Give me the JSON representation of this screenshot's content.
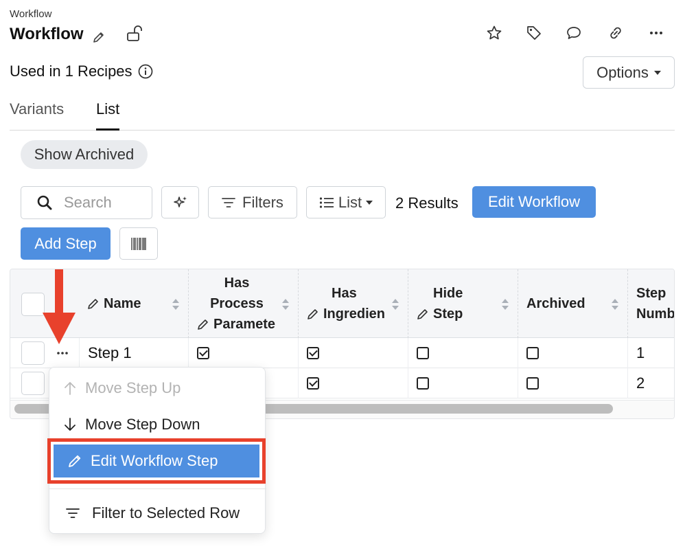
{
  "header": {
    "breadcrumb": "Workflow",
    "title": "Workflow",
    "used_in": "Used in 1 Recipes",
    "options_label": "Options"
  },
  "tabs": [
    {
      "label": "Variants",
      "active": false
    },
    {
      "label": "List",
      "active": true
    }
  ],
  "toolbar": {
    "show_archived": "Show Archived",
    "search_placeholder": "Search",
    "filters_label": "Filters",
    "list_label": "List",
    "results": "2 Results",
    "edit_workflow": "Edit Workflow",
    "add_step": "Add Step"
  },
  "table": {
    "columns": [
      {
        "label": "Name",
        "editable": true
      },
      {
        "label": "Has Process Paramete",
        "editable": true
      },
      {
        "label": "Has Ingredien",
        "editable": true
      },
      {
        "label": "Hide Step",
        "editable": true
      },
      {
        "label": "Archived",
        "editable": false
      },
      {
        "label": "Step Numb",
        "editable": false
      }
    ],
    "col_lines": {
      "c1": "Name",
      "c2a": "Has",
      "c2b": "Process",
      "c2c": "Paramete",
      "c3a": "Has",
      "c3b": "Ingredien",
      "c4a": "Hide",
      "c4b": "Step",
      "c5": "Archived",
      "c6a": "Step",
      "c6b": "Numb"
    },
    "rows": [
      {
        "name": "Step 1",
        "has_process_parameters": true,
        "has_ingredients": true,
        "hide_step": false,
        "archived": false,
        "step_number": "1"
      },
      {
        "name": "",
        "has_process_parameters": null,
        "has_ingredients": true,
        "hide_step": false,
        "archived": false,
        "step_number": "2"
      }
    ]
  },
  "context_menu": {
    "items": [
      {
        "label": "Move Step Up",
        "icon": "arrow-up-icon",
        "disabled": true
      },
      {
        "label": "Move Step Down",
        "icon": "arrow-down-icon",
        "disabled": false
      },
      {
        "label": "Edit Workflow Step",
        "icon": "pencil-icon",
        "highlighted": true
      },
      {
        "label": "Filter to Selected Row",
        "icon": "filter-icon",
        "disabled": false
      }
    ]
  },
  "colors": {
    "primary": "#4f8fe0",
    "annotation_red": "#e8412c"
  }
}
